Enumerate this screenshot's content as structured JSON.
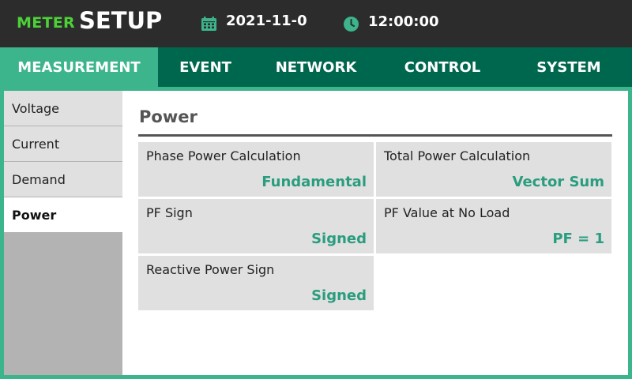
{
  "header": {
    "brand_prefix": "METER",
    "brand_title": "SETUP",
    "date_icon": "calendar-icon",
    "date": "2021-11-0",
    "time_icon": "clock-icon",
    "time": "12:00:00"
  },
  "tabs": [
    {
      "label": "MEASUREMENT",
      "active": true
    },
    {
      "label": "EVENT",
      "active": false
    },
    {
      "label": "NETWORK",
      "active": false
    },
    {
      "label": "CONTROL",
      "active": false
    },
    {
      "label": "SYSTEM",
      "active": false
    }
  ],
  "sidebar": {
    "items": [
      {
        "label": "Voltage",
        "active": false
      },
      {
        "label": "Current",
        "active": false
      },
      {
        "label": "Demand",
        "active": false
      },
      {
        "label": "Power",
        "active": true
      }
    ]
  },
  "panel": {
    "title": "Power",
    "settings": [
      {
        "label": "Phase Power Calculation",
        "value": "Fundamental"
      },
      {
        "label": "Total Power Calculation",
        "value": "Vector Sum"
      },
      {
        "label": "PF Sign",
        "value": "Signed"
      },
      {
        "label": "PF Value at No Load",
        "value": "PF = 1"
      },
      {
        "label": "Reactive Power Sign",
        "value": "Signed"
      }
    ]
  },
  "colors": {
    "accent": "#3cb48c",
    "tab_bar": "#00674f",
    "header_bg": "#2c2c2c",
    "brand_green": "#4cd137",
    "value_text": "#2a9d7f"
  }
}
